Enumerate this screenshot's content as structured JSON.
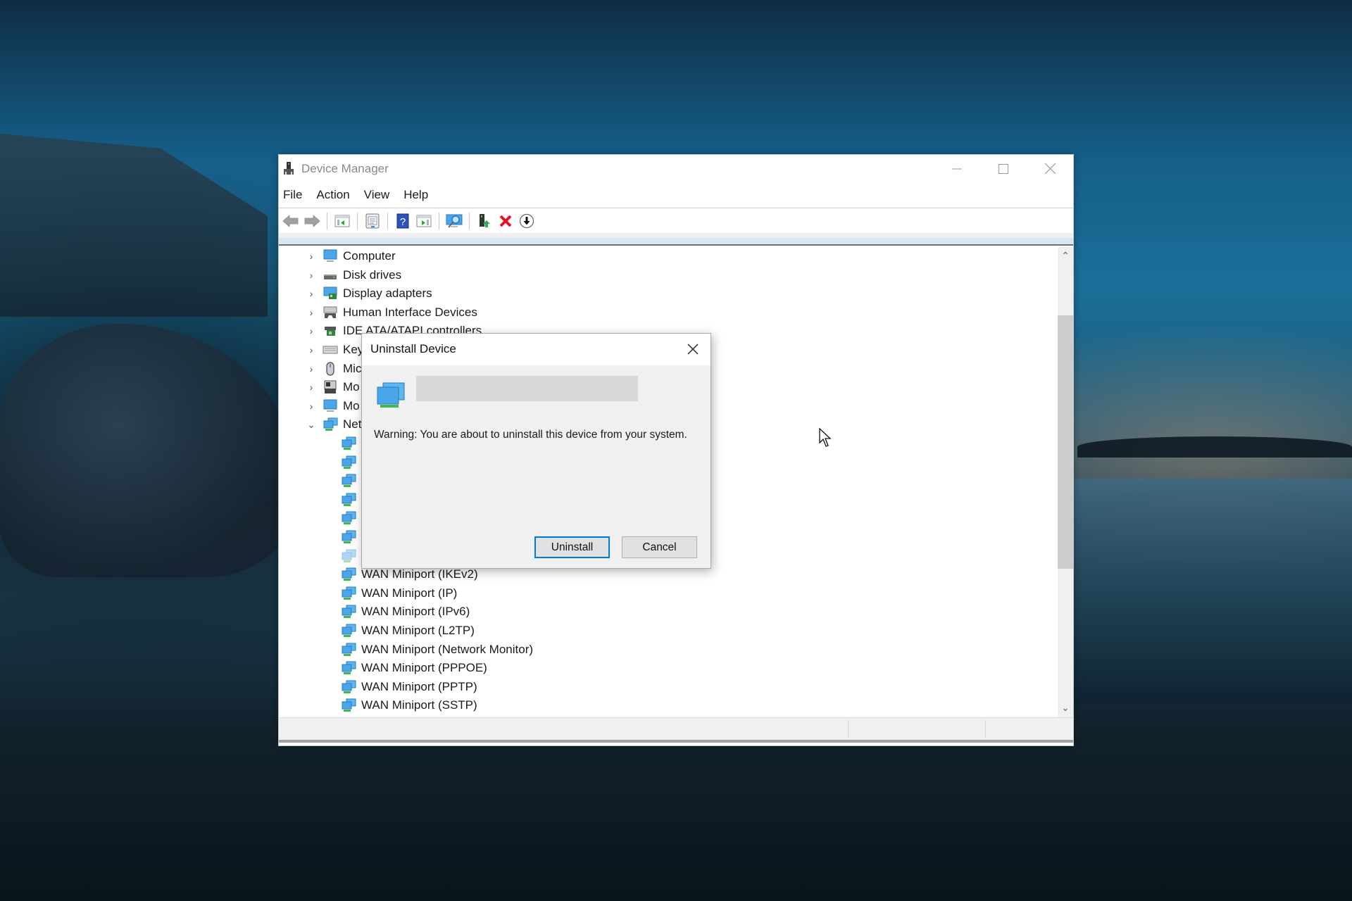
{
  "window": {
    "title": "Device Manager",
    "controls": {
      "minimize": "minimize-icon",
      "maximize": "maximize-icon",
      "close": "close-icon"
    },
    "menu": [
      "File",
      "Action",
      "View",
      "Help"
    ],
    "toolbar": [
      {
        "icon": "back-arrow-icon",
        "enabled": false
      },
      {
        "icon": "forward-arrow-icon",
        "enabled": false
      },
      {
        "icon": "show-hide-console-tree-icon"
      },
      {
        "icon": "properties-icon"
      },
      {
        "icon": "help-icon"
      },
      {
        "icon": "show-action-pane-icon"
      },
      {
        "icon": "scan-hardware-changes-icon"
      },
      {
        "icon": "update-driver-icon"
      },
      {
        "icon": "uninstall-device-icon"
      },
      {
        "icon": "disable-device-icon"
      }
    ]
  },
  "tree": {
    "categories": [
      {
        "label": "Computer",
        "expanded": false,
        "icon": "computer-icon"
      },
      {
        "label": "Disk drives",
        "expanded": false,
        "icon": "disk-drive-icon"
      },
      {
        "label": "Display adapters",
        "expanded": false,
        "icon": "display-adapter-icon"
      },
      {
        "label": "Human Interface Devices",
        "expanded": false,
        "icon": "hid-icon"
      },
      {
        "label": "IDE ATA/ATAPI controllers",
        "expanded": false,
        "icon": "ide-controller-icon"
      },
      {
        "label": "Key",
        "expanded": false,
        "icon": "keyboard-icon"
      },
      {
        "label": "Mic",
        "expanded": false,
        "icon": "mouse-icon"
      },
      {
        "label": "Mo",
        "expanded": false,
        "icon": "modem-icon"
      },
      {
        "label": "Mo",
        "expanded": false,
        "icon": "monitor-icon"
      },
      {
        "label": "Net",
        "expanded": true,
        "icon": "network-adapter-icon"
      }
    ],
    "network_children": [
      "",
      "",
      "",
      "",
      "",
      "",
      "",
      "WAN Miniport (IKEv2)",
      "WAN Miniport (IP)",
      "WAN Miniport (IPv6)",
      "WAN Miniport (L2TP)",
      "WAN Miniport (Network Monitor)",
      "WAN Miniport (PPPOE)",
      "WAN Miniport (PPTP)",
      "WAN Miniport (SSTP)"
    ]
  },
  "dialog": {
    "title": "Uninstall Device",
    "device_name": "",
    "warning": "Warning: You are about to uninstall this device from your system.",
    "uninstall_label": "Uninstall",
    "cancel_label": "Cancel"
  },
  "colors": {
    "accent": "#0078d7",
    "uninstall_red": "#e81123"
  }
}
